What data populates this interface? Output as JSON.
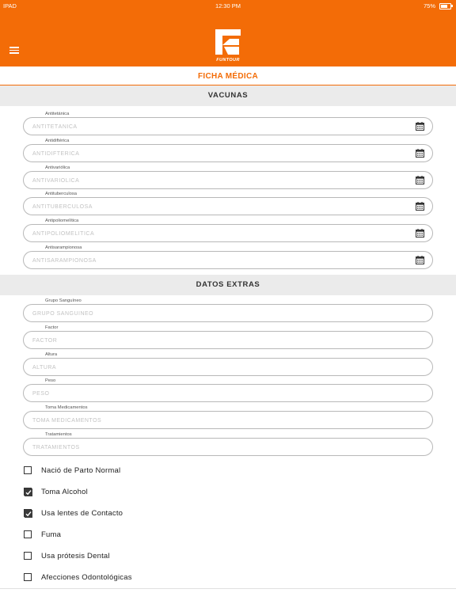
{
  "status_bar": {
    "device": "IPAD",
    "time": "12:30 PM",
    "battery": "75%"
  },
  "header": {
    "logo_text": "FUNTOUR",
    "menu_icon": "hamburger-icon"
  },
  "page": {
    "title": "FICHA MÉDICA"
  },
  "vacunas": {
    "title": "VACUNAS",
    "fields": [
      {
        "label": "Antitetánica",
        "placeholder": "ANTITETÁNICA",
        "icon": "calendar-icon"
      },
      {
        "label": "Antidiftérica",
        "placeholder": "ANTIDIFTÉRICA",
        "icon": "calendar-icon"
      },
      {
        "label": "Antivariólica",
        "placeholder": "ANTIVARIÓLICA",
        "icon": "calendar-icon"
      },
      {
        "label": "Antituberculosa",
        "placeholder": "ANTITUBERCULOSA",
        "icon": "calendar-icon"
      },
      {
        "label": "Antipoliomelítica",
        "placeholder": "ANTIPOLIOMELÍTICA",
        "icon": "calendar-icon"
      },
      {
        "label": "Antisarampionosa",
        "placeholder": "ANTISARAMPIONOSA",
        "icon": "calendar-icon"
      }
    ]
  },
  "datos_extras": {
    "title": "DATOS EXTRAS",
    "fields": [
      {
        "label": "Grupo Sanguíneo",
        "placeholder": "GRUPO SANGUÍNEO"
      },
      {
        "label": "Factor",
        "placeholder": "FACTOR"
      },
      {
        "label": "Altura",
        "placeholder": "ALTURA"
      },
      {
        "label": "Peso",
        "placeholder": "PESO"
      },
      {
        "label": "Toma Medicamentos",
        "placeholder": "TOMA MEDICAMENTOS"
      },
      {
        "label": "Tratamientos",
        "placeholder": "TRATAMIENTOS"
      }
    ]
  },
  "checkboxes": [
    {
      "label": "Nació de Parto Normal",
      "checked": false
    },
    {
      "label": "Toma Alcohol",
      "checked": true
    },
    {
      "label": "Usa lentes de Contacto",
      "checked": true
    },
    {
      "label": "Fuma",
      "checked": false
    },
    {
      "label": "Usa prótesis Dental",
      "checked": false
    },
    {
      "label": "Afecciones Odontológicas",
      "checked": false
    }
  ],
  "colors": {
    "accent": "#f36c07",
    "section_bg": "#ebebeb",
    "field_border": "#b8b8b8"
  }
}
